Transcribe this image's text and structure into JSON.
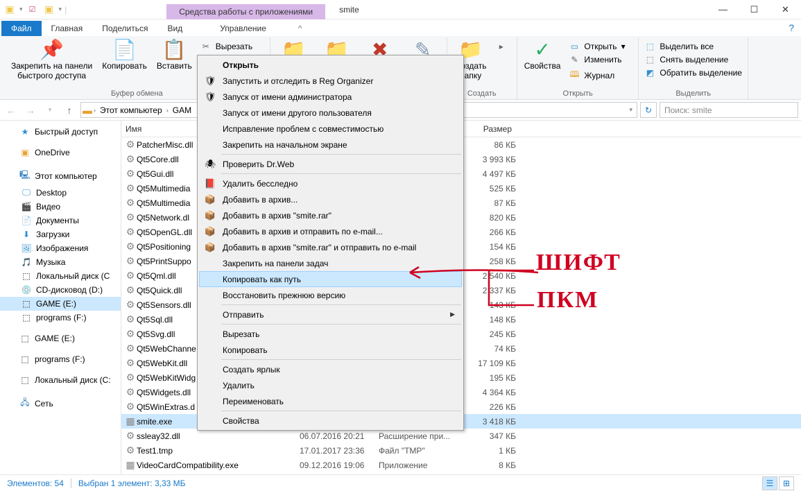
{
  "title": "smite",
  "context_tab": "Средства работы с приложениями",
  "tabs": {
    "file": "Файл",
    "home": "Главная",
    "share": "Поделиться",
    "view": "Вид",
    "manage": "Управление"
  },
  "ribbon": {
    "pin": "Закрепить на панели\nбыстрого доступа",
    "copy": "Копировать",
    "paste": "Вставить",
    "cut": "Вырезать",
    "group_clipboard": "Буфер обмена",
    "new_folder": "Создать\nпапку",
    "group_create": "Создать",
    "properties": "Свойства",
    "open": "Открыть",
    "edit": "Изменить",
    "history": "Журнал",
    "group_open": "Открыть",
    "select_all": "Выделить все",
    "select_none": "Снять выделение",
    "invert_sel": "Обратить выделение",
    "group_select": "Выделить"
  },
  "breadcrumb": [
    "Этот компьютер",
    "GAM"
  ],
  "search_placeholder": "Поиск: smite",
  "nav": {
    "quick": "Быстрый доступ",
    "onedrive": "OneDrive",
    "this_pc": "Этот компьютер",
    "desktop": "Desktop",
    "video": "Видео",
    "documents": "Документы",
    "downloads": "Загрузки",
    "pictures": "Изображения",
    "music": "Музыка",
    "localc": "Локальный диск (C",
    "cddrive": "CD-дисковод (D:)",
    "game_e": "GAME (E:)",
    "programs_f": "programs (F:)",
    "game_e2": "GAME (E:)",
    "programs_f2": "programs (F:)",
    "localc2": "Локальный диск (C:",
    "network": "Сеть"
  },
  "columns": {
    "name": "Имя",
    "date": "",
    "type": "",
    "size": "Размер"
  },
  "files": [
    {
      "name": "PatcherMisc.dll",
      "date": "",
      "type": "",
      "size": "86 КБ"
    },
    {
      "name": "Qt5Core.dll",
      "date": "",
      "type": "",
      "size": "3 993 КБ"
    },
    {
      "name": "Qt5Gui.dll",
      "date": "",
      "type": "",
      "size": "4 497 КБ"
    },
    {
      "name": "Qt5Multimedia",
      "date": "",
      "type": "",
      "size": "525 КБ"
    },
    {
      "name": "Qt5Multimedia",
      "date": "",
      "type": "",
      "size": "87 КБ"
    },
    {
      "name": "Qt5Network.dl",
      "date": "",
      "type": "",
      "size": "820 КБ"
    },
    {
      "name": "Qt5OpenGL.dll",
      "date": "",
      "type": "",
      "size": "266 КБ"
    },
    {
      "name": "Qt5Positioning",
      "date": "",
      "type": "",
      "size": "154 КБ"
    },
    {
      "name": "Qt5PrintSuppo",
      "date": "",
      "type": "",
      "size": "258 КБ"
    },
    {
      "name": "Qt5Qml.dll",
      "date": "",
      "type": "",
      "size": "2 540 КБ"
    },
    {
      "name": "Qt5Quick.dll",
      "date": "",
      "type": "",
      "size": "2 337 КБ"
    },
    {
      "name": "Qt5Sensors.dll",
      "date": "",
      "type": "",
      "size": "143 КБ"
    },
    {
      "name": "Qt5Sql.dll",
      "date": "",
      "type": "",
      "size": "148 КБ"
    },
    {
      "name": "Qt5Svg.dll",
      "date": "",
      "type": "",
      "size": "245 КБ"
    },
    {
      "name": "Qt5WebChanne",
      "date": "",
      "type": "",
      "size": "74 КБ"
    },
    {
      "name": "Qt5WebKit.dll",
      "date": "",
      "type": "",
      "size": "17 109 КБ"
    },
    {
      "name": "Qt5WebKitWidg",
      "date": "",
      "type": "",
      "size": "195 КБ"
    },
    {
      "name": "Qt5Widgets.dll",
      "date": "",
      "type": "",
      "size": "4 364 КБ"
    },
    {
      "name": "Qt5WinExtras.d",
      "date": "",
      "type": "",
      "size": "226 КБ"
    },
    {
      "name": "smite.exe",
      "date": "",
      "type": "",
      "size": "3 418 КБ",
      "selected": true,
      "icon": "app"
    },
    {
      "name": "ssleay32.dll",
      "date": "06.07.2016 20:21",
      "type": "Расширение при...",
      "size": "347 КБ"
    },
    {
      "name": "Test1.tmp",
      "date": "17.01.2017 23:36",
      "type": "Файл \"TMP\"",
      "size": "1 КБ"
    },
    {
      "name": "VideoCardCompatibility.exe",
      "date": "09.12.2016 19:06",
      "type": "Приложение",
      "size": "8 КБ",
      "icon": "app"
    }
  ],
  "context_menu": [
    {
      "label": "Открыть",
      "bold": true
    },
    {
      "label": "Запустить и отследить в Reg Organizer",
      "icon": "🛡"
    },
    {
      "label": "Запуск от имени администратора",
      "icon": "🛡"
    },
    {
      "label": "Запуск от имени другого пользователя"
    },
    {
      "label": "Исправление проблем с совместимостью"
    },
    {
      "label": "Закрепить на начальном экране"
    },
    {
      "sep": true
    },
    {
      "label": "Проверить Dr.Web",
      "icon": "🕷"
    },
    {
      "sep": true
    },
    {
      "label": "Удалить бесследно",
      "icon": "📕"
    },
    {
      "label": "Добавить в архив...",
      "icon": "📦"
    },
    {
      "label": "Добавить в архив \"smite.rar\"",
      "icon": "📦"
    },
    {
      "label": "Добавить в архив и отправить по e-mail...",
      "icon": "📦"
    },
    {
      "label": "Добавить в архив \"smite.rar\" и отправить по e-mail",
      "icon": "📦"
    },
    {
      "label": "Закрепить на панели задач"
    },
    {
      "label": "Копировать как путь",
      "hover": true
    },
    {
      "label": "Восстановить прежнюю версию"
    },
    {
      "sep": true
    },
    {
      "label": "Отправить",
      "submenu": true
    },
    {
      "sep": true
    },
    {
      "label": "Вырезать"
    },
    {
      "label": "Копировать"
    },
    {
      "sep": true
    },
    {
      "label": "Создать ярлык"
    },
    {
      "label": "Удалить"
    },
    {
      "label": "Переименовать"
    },
    {
      "sep": true
    },
    {
      "label": "Свойства"
    }
  ],
  "status": {
    "items": "Элементов: 54",
    "selected": "Выбран 1 элемент: 3,33 МБ"
  },
  "annotations": {
    "shift": "ШИФТ",
    "pkm": "ПКМ"
  }
}
